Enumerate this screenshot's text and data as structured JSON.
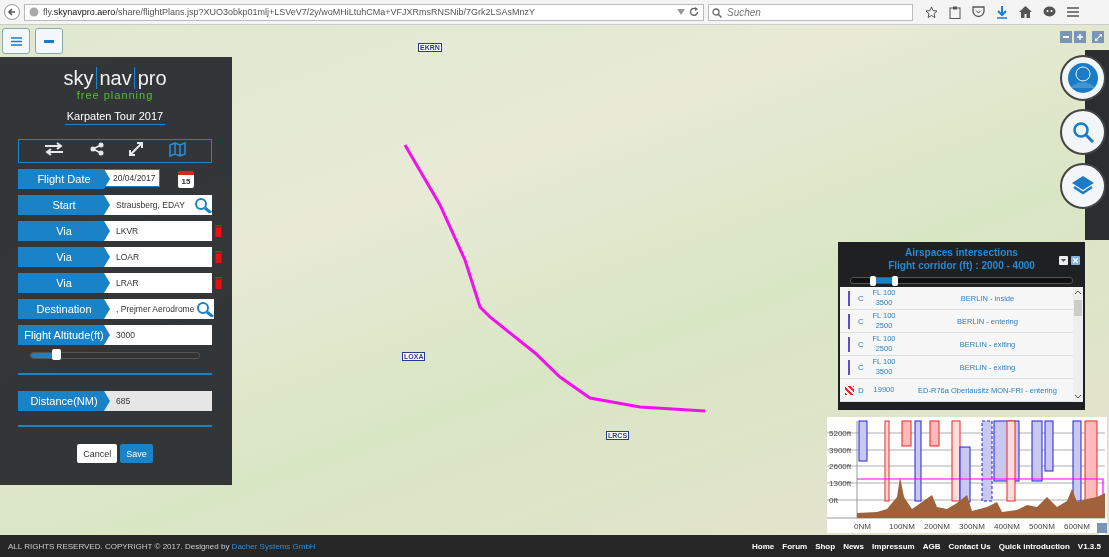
{
  "browser": {
    "url": "fly.**skynavpro.aero**/share/flightPlans.jsp?XUO3obkp01mlj+LSVeV7/2y/woMHiLtuhCMa+VFJXRmsRNSNib/7Grk2LSAsMnzY",
    "search": {
      "placeholder": "Suchen"
    }
  },
  "map": {
    "airports": [
      {
        "code": "EKRN"
      },
      {
        "code": "LOXA"
      },
      {
        "code": "LRCS"
      }
    ]
  },
  "planner": {
    "logo": {
      "sky": "sky",
      "nav": "nav",
      "pro": "pro",
      "tagline": "free planning"
    },
    "title": "Karpaten Tour 2017",
    "tools": [
      {
        "kind": "swap",
        "selected": false
      },
      {
        "kind": "share",
        "selected": false
      },
      {
        "kind": "expand",
        "selected": false
      },
      {
        "kind": "map",
        "selected": true
      }
    ],
    "fields": [
      {
        "kind": "date",
        "label": "Flight Date",
        "value": "20/04/2017",
        "calendar_day": "15"
      },
      {
        "kind": "search",
        "label": "Start",
        "value": "Strausberg, EDAY"
      },
      {
        "kind": "waypoint",
        "label": "Via",
        "value": "LKVR"
      },
      {
        "kind": "waypoint",
        "label": "Via",
        "value": "LOAR"
      },
      {
        "kind": "waypoint",
        "label": "Via",
        "value": "LRAR"
      },
      {
        "kind": "search",
        "label": "Destination",
        "value": ", Prejmer Aerodrome"
      },
      {
        "kind": "plain",
        "label": "Flight Altitude(ft)",
        "value": "3000"
      }
    ],
    "altitude_slider": {
      "level": 0.15
    },
    "distance": {
      "label": "Distance(NM)",
      "value": "685"
    },
    "buttons": [
      {
        "kind": "secondary",
        "label": "Cancel"
      },
      {
        "kind": "primary",
        "label": "Save"
      }
    ]
  },
  "airspaces": {
    "title": "Airspaces intersections",
    "subtitle": "Flight corridor (ft) : 2000 - 4000",
    "corridor_thumbs": [
      {
        "level": 0.1
      },
      {
        "level": 0.2
      }
    ],
    "rows": [
      {
        "kind": "solid",
        "color": "#5b4fd6",
        "class": "C",
        "upper": "FL 100",
        "lower": "3500",
        "name": "BERLIN - inside"
      },
      {
        "kind": "solid",
        "color": "#5b4fd6",
        "class": "C",
        "upper": "FL 100",
        "lower": "2500",
        "name": "BERLIN - entering"
      },
      {
        "kind": "solid",
        "color": "#5b4fd6",
        "class": "C",
        "upper": "FL 100",
        "lower": "2500",
        "name": "BERLIN - exiting"
      },
      {
        "kind": "solid",
        "color": "#5b4fd6",
        "class": "C",
        "upper": "FL 100",
        "lower": "3500",
        "name": "BERLIN - exiting"
      },
      {
        "kind": "hatched",
        "color": "#e0302a",
        "class": "D",
        "upper": "19900",
        "lower": "",
        "name": "ED-R76a Oberlausitz MON-FRI - entering"
      }
    ]
  },
  "profile": {
    "y_labels": [
      "5200ft",
      "3900ft",
      "2600ft",
      "1300ft",
      "0ft"
    ],
    "x_labels": [
      "0NM",
      "100NM",
      "200NM",
      "300NM",
      "400NM",
      "500NM",
      "600NM"
    ]
  },
  "footer": {
    "copyright": "ALL RIGHTS RESERVED. COPYRIGHT © 2017. Designed by",
    "designer": "Dacher Systems GmbH",
    "links": [
      "Home",
      "Forum",
      "Shop",
      "News",
      "Impressum",
      "AGB",
      "Contact Us",
      "Quick introduction"
    ],
    "version": "V1.3.5"
  }
}
